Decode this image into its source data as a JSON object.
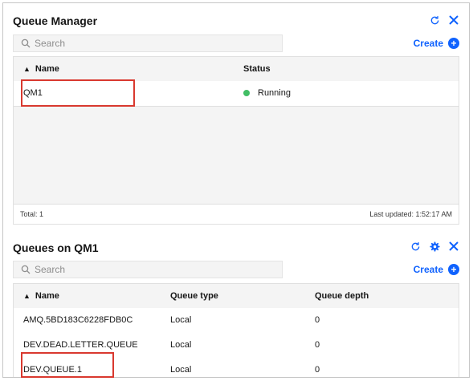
{
  "queue_manager": {
    "title": "Queue Manager",
    "search_placeholder": "Search",
    "create_label": "Create",
    "columns": {
      "name": "Name",
      "status": "Status"
    },
    "sort_indicator": "▲",
    "rows": [
      {
        "name": "QM1",
        "status": "Running",
        "status_color": "#42be65"
      }
    ],
    "total": "Total: 1",
    "last_updated": "Last updated: 1:52:17 AM"
  },
  "queues": {
    "title": "Queues on QM1",
    "search_placeholder": "Search",
    "create_label": "Create",
    "sort_indicator": "▲",
    "columns": {
      "name": "Name",
      "type": "Queue type",
      "depth": "Queue depth"
    },
    "rows": [
      {
        "name": "AMQ.5BD183C6228FDB0C",
        "type": "Local",
        "depth": "0"
      },
      {
        "name": "DEV.DEAD.LETTER.QUEUE",
        "type": "Local",
        "depth": "0"
      },
      {
        "name": "DEV.QUEUE.1",
        "type": "Local",
        "depth": "0"
      }
    ]
  },
  "colors": {
    "accent": "#0f62fe",
    "highlight": "#d9392f",
    "running": "#42be65"
  },
  "icons": {
    "refresh": "refresh-icon",
    "close": "close-icon",
    "settings": "gear-icon",
    "search": "search-icon",
    "add": "add-icon"
  }
}
